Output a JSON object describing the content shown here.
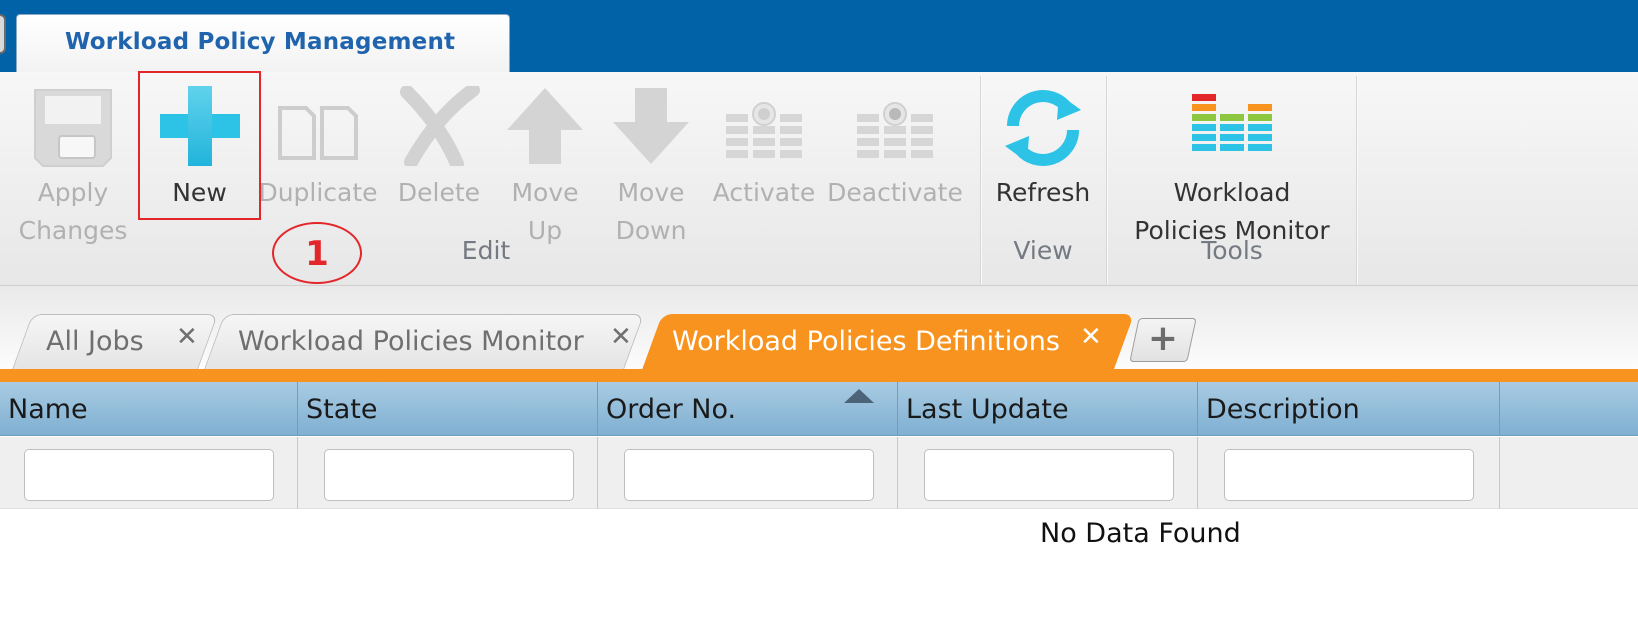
{
  "app": {
    "title": "Workload Policy Management"
  },
  "ribbon": {
    "buttons": [
      {
        "id": "apply",
        "label": "Apply\nChanges",
        "enabled": false
      },
      {
        "id": "new",
        "label": "New",
        "enabled": true
      },
      {
        "id": "duplicate",
        "label": "Duplicate",
        "enabled": false
      },
      {
        "id": "delete",
        "label": "Delete",
        "enabled": false
      },
      {
        "id": "move_up",
        "label": "Move\nUp",
        "enabled": false
      },
      {
        "id": "move_down",
        "label": "Move\nDown",
        "enabled": false
      },
      {
        "id": "activate",
        "label": "Activate",
        "enabled": false
      },
      {
        "id": "deactivate",
        "label": "Deactivate",
        "enabled": false
      },
      {
        "id": "refresh",
        "label": "Refresh",
        "enabled": true
      },
      {
        "id": "wp_monitor",
        "label": "Workload\nPolicies Monitor",
        "enabled": true
      }
    ],
    "groups": {
      "edit": "Edit",
      "view": "View",
      "tools": "Tools"
    },
    "annotation": {
      "step": "1"
    }
  },
  "tabs": [
    {
      "label": "All Jobs",
      "close": "✕",
      "active": false
    },
    {
      "label": "Workload Policies Monitor",
      "close": "✕",
      "active": false
    },
    {
      "label": "Workload Policies Definitions",
      "close": "✕",
      "active": true
    }
  ],
  "add_tab": {
    "label": "+"
  },
  "grid": {
    "columns": [
      "Name",
      "State",
      "Order No.",
      "Last Update",
      "Description"
    ],
    "sorted_column": "Order No.",
    "sort_direction": "ascending",
    "filter_values": [
      "",
      "",
      "",
      "",
      ""
    ],
    "empty_message": "No Data Found"
  },
  "colors": {
    "topbar": "#0162a8",
    "app_title": "#1f64ad",
    "accent_orange": "#f7931e",
    "highlight_red": "#e3262a",
    "header_blue": "#7fb0d2"
  }
}
